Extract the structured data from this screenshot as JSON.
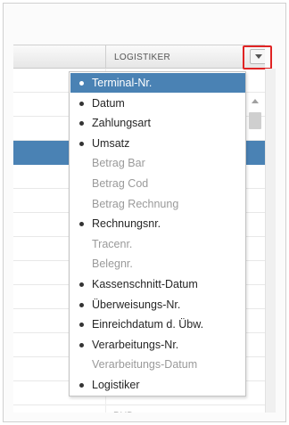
{
  "grid": {
    "column_title": "LOGISTIKER",
    "last_row_value": "PUD"
  },
  "column_menu": {
    "items": [
      {
        "label": "Terminal-Nr.",
        "checked": true,
        "active": true
      },
      {
        "label": "Datum",
        "checked": true,
        "active": false
      },
      {
        "label": "Zahlungsart",
        "checked": true,
        "active": false
      },
      {
        "label": "Umsatz",
        "checked": true,
        "active": false
      },
      {
        "label": "Betrag Bar",
        "checked": false,
        "active": false
      },
      {
        "label": "Betrag Cod",
        "checked": false,
        "active": false
      },
      {
        "label": "Betrag Rechnung",
        "checked": false,
        "active": false
      },
      {
        "label": "Rechnungsnr.",
        "checked": true,
        "active": false
      },
      {
        "label": "Tracenr.",
        "checked": false,
        "active": false
      },
      {
        "label": "Belegnr.",
        "checked": false,
        "active": false
      },
      {
        "label": "Kassenschnitt-Datum",
        "checked": true,
        "active": false
      },
      {
        "label": "Überweisungs-Nr.",
        "checked": true,
        "active": false
      },
      {
        "label": "Einreichdatum d. Übw.",
        "checked": true,
        "active": false
      },
      {
        "label": "Verarbeitungs-Nr.",
        "checked": true,
        "active": false
      },
      {
        "label": "Verarbeitungs-Datum",
        "checked": false,
        "active": false
      },
      {
        "label": "Logistiker",
        "checked": true,
        "active": false
      }
    ]
  },
  "colors": {
    "accent": "#4a82b4",
    "highlight": "#e02424"
  },
  "icons": {
    "trigger": "chevron-down-icon",
    "bullet": "bullet-icon",
    "scroll_up": "arrow-up-icon"
  }
}
